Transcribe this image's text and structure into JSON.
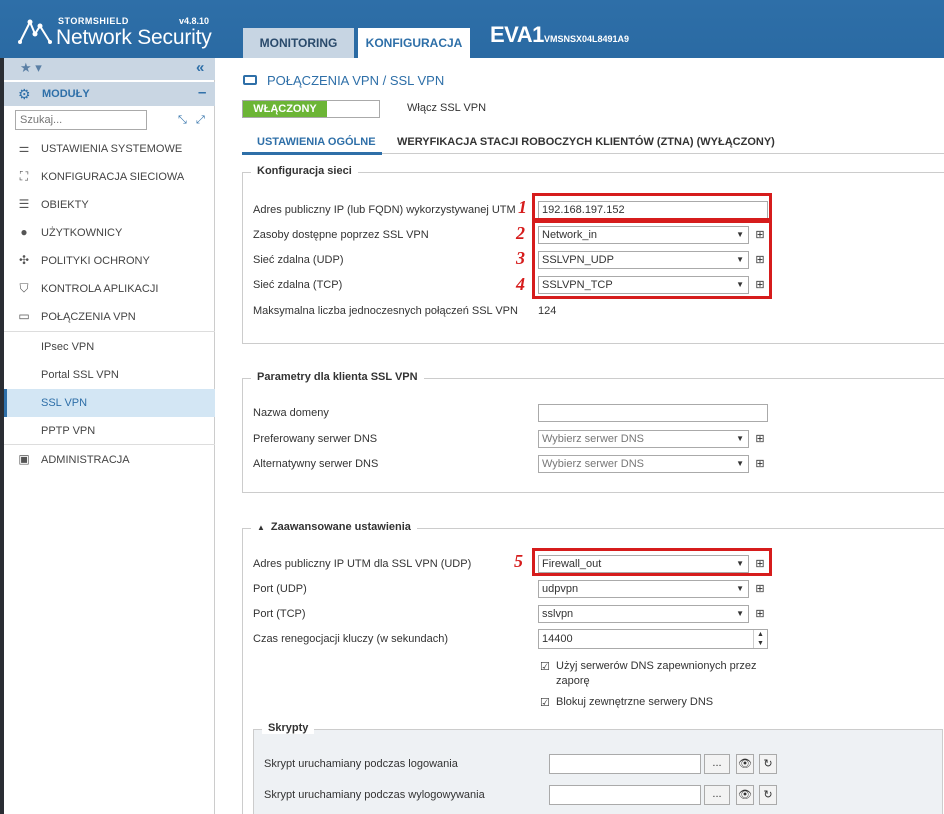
{
  "app": {
    "brand": "STORMSHIELD",
    "product": "Network Security",
    "version": "v4.8.10",
    "device_name": "EVA1",
    "device_serial": "VMSNSX04L8491A9"
  },
  "top_tabs": {
    "monitoring": "MONITORING",
    "konfiguracja": "KONFIGURACJA"
  },
  "sidebar": {
    "modules_label": "MODUŁY",
    "search_placeholder": "Szukaj...",
    "items": [
      {
        "label": "USTAWIENIA SYSTEMOWE",
        "icon": "sliders-icon"
      },
      {
        "label": "KONFIGURACJA SIECIOWA",
        "icon": "network-icon"
      },
      {
        "label": "OBIEKTY",
        "icon": "database-icon"
      },
      {
        "label": "UŻYTKOWNICY",
        "icon": "user-icon"
      },
      {
        "label": "POLITYKI OCHRONY",
        "icon": "arrows-icon"
      },
      {
        "label": "KONTROLA APLIKACJI",
        "icon": "shield-icon"
      },
      {
        "label": "POŁĄCZENIA VPN",
        "icon": "vpn-icon"
      }
    ],
    "sub_items": [
      {
        "label": "IPsec VPN"
      },
      {
        "label": "Portal SSL VPN"
      },
      {
        "label": "SSL VPN",
        "active": true
      },
      {
        "label": "PPTP VPN"
      }
    ],
    "admin": {
      "label": "ADMINISTRACJA",
      "icon": "admin-icon"
    }
  },
  "page": {
    "title": "POŁĄCZENIA VPN / SSL VPN",
    "toggle_label": "WŁĄCZONY",
    "toggle_desc": "Włącz SSL VPN",
    "subtabs": [
      "USTAWIENIA OGÓLNE",
      "WERYFIKACJA STACJI ROBOCZYCH KLIENTÓW (ZTNA) (WYŁĄCZONY)"
    ]
  },
  "network_config": {
    "legend": "Konfiguracja sieci",
    "public_ip_label": "Adres publiczny IP (lub FQDN) wykorzystywanej UTM",
    "public_ip_value": "192.168.197.152",
    "resources_label": "Zasoby dostępne poprzez SSL VPN",
    "resources_value": "Network_in",
    "udp_label": "Sieć zdalna (UDP)",
    "udp_value": "SSLVPN_UDP",
    "tcp_label": "Sieć zdalna (TCP)",
    "tcp_value": "SSLVPN_TCP",
    "max_label": "Maksymalna liczba jednoczesnych połączeń SSL VPN",
    "max_value": "124"
  },
  "client_params": {
    "legend": "Parametry dla klienta SSL VPN",
    "domain_label": "Nazwa domeny",
    "domain_value": "",
    "dns1_label": "Preferowany serwer DNS",
    "dns1_placeholder": "Wybierz serwer DNS",
    "dns2_label": "Alternatywny serwer DNS",
    "dns2_placeholder": "Wybierz serwer DNS"
  },
  "advanced": {
    "legend": "Zaawansowane ustawienia",
    "udp_ip_label": "Adres publiczny IP UTM dla SSL VPN (UDP)",
    "udp_ip_value": "Firewall_out",
    "port_udp_label": "Port (UDP)",
    "port_udp_value": "udpvpn",
    "port_tcp_label": "Port (TCP)",
    "port_tcp_value": "sslvpn",
    "renegotiation_label": "Czas renegocjacji kluczy (w sekundach)",
    "renegotiation_value": "14400",
    "dns_checkbox": "Użyj serwerów DNS zapewnionych przez zaporę",
    "block_dns_checkbox": "Blokuj zewnętrzne serwery DNS"
  },
  "scripts": {
    "legend": "Skrypty",
    "login_label": "Skrypt uruchamiany podczas logowania",
    "logout_label": "Skrypt uruchamiany podczas wylogowywania",
    "browse": "..."
  },
  "annotations": [
    "1",
    "2",
    "3",
    "4",
    "5"
  ],
  "colors": {
    "accent": "#2e6fa8",
    "highlight": "#d61c1c",
    "toggle_on": "#6cb536"
  }
}
